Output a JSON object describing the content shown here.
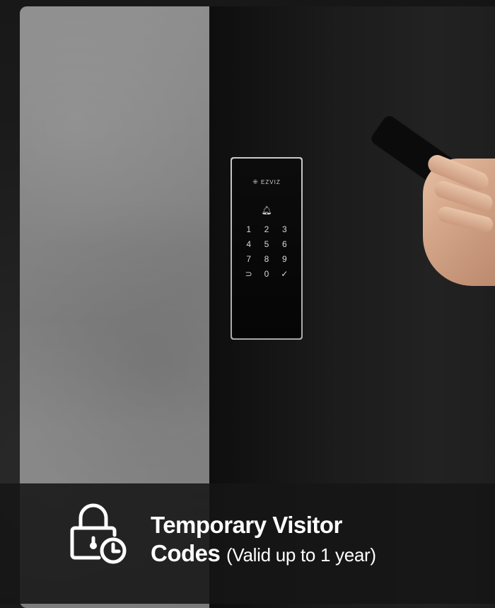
{
  "keypad": {
    "brand": "EZVIZ",
    "keys": [
      "1",
      "2",
      "3",
      "4",
      "5",
      "6",
      "7",
      "8",
      "9",
      "⊃",
      "0",
      "✓"
    ]
  },
  "caption": {
    "title_line1": "Temporary Visitor",
    "title_line2": "Codes",
    "subtitle": "(Valid up to 1 year)",
    "icon": "lock-clock-icon"
  },
  "colors": {
    "caption_bg": "#161616",
    "text": "#ffffff"
  }
}
